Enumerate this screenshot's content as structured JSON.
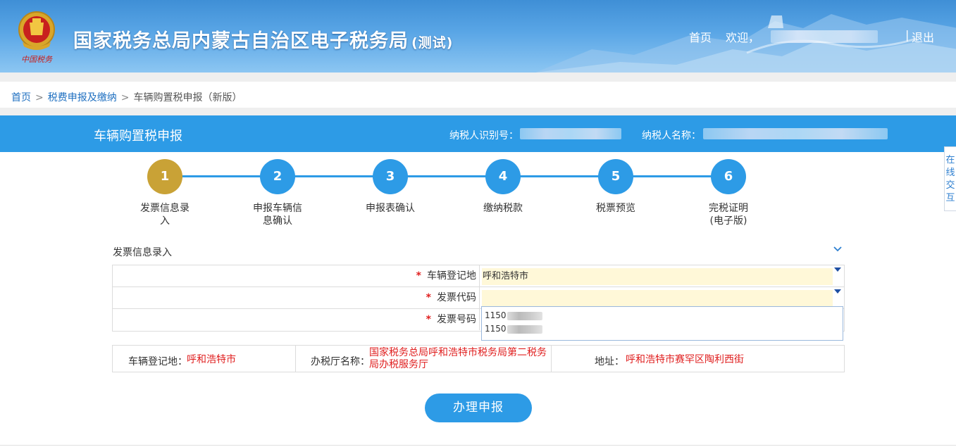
{
  "header": {
    "title": "国家税务总局内蒙古自治区电子税务局",
    "title_suffix": "(测试)",
    "emblem_text": "中国税务",
    "home_link": "首页",
    "welcome": "欢迎，",
    "separator": "|",
    "logout": "退出"
  },
  "breadcrumb": {
    "home": "首页",
    "sep": ">",
    "level2": "税费申报及缴纳",
    "current": "车辆购置税申报（新版）"
  },
  "titlebar": {
    "title": "车辆购置税申报",
    "taxpayer_id_label": "纳税人识别号：",
    "taxpayer_name_label": "纳税人名称："
  },
  "steps": [
    {
      "num": "1",
      "label": "发票信息录入",
      "active": true
    },
    {
      "num": "2",
      "label": "申报车辆信息确认",
      "active": false
    },
    {
      "num": "3",
      "label": "申报表确认",
      "active": false
    },
    {
      "num": "4",
      "label": "缴纳税款",
      "active": false
    },
    {
      "num": "5",
      "label": "税票预览",
      "active": false
    },
    {
      "num": "6",
      "label": "完税证明(电子版)",
      "active": false
    }
  ],
  "side_tab": "在线交互",
  "section": {
    "title": "发票信息录入"
  },
  "form": {
    "required_mark": "*",
    "registration_label": "车辆登记地",
    "registration_value": "呼和浩特市",
    "invoice_code_label": "发票代码",
    "invoice_code_value": "",
    "invoice_number_label": "发票号码",
    "invoice_number_value": ""
  },
  "dropdown": {
    "options": [
      "1150",
      "1150"
    ]
  },
  "info": {
    "reg_label": "车辆登记地：",
    "reg_value": "呼和浩特市",
    "office_label": "办税厅名称：",
    "office_value_line1": "国家税务总局呼和浩特市税务局第二税务",
    "office_value_line2": "局办税服务厅",
    "addr_label": "地址：",
    "addr_value": "呼和浩特市赛罕区陶利西街"
  },
  "submit": "办理申报",
  "colors": {
    "primary": "#2d9be6",
    "active_step": "#c9a236",
    "required": "#e02020",
    "input_bg": "#fff8d8"
  }
}
